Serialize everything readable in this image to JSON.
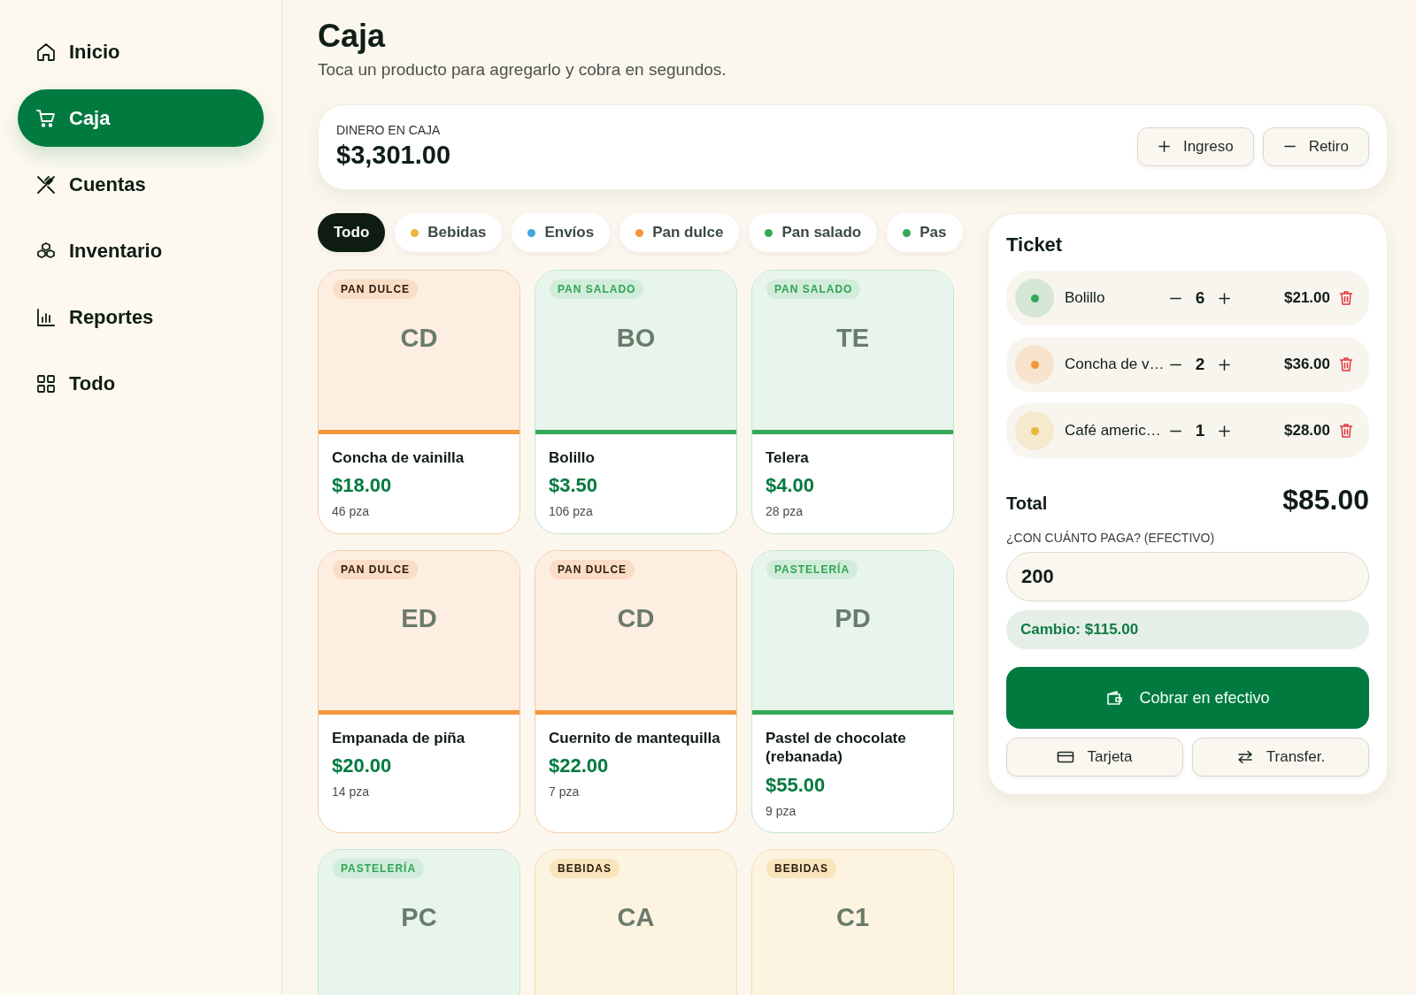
{
  "sidebar": {
    "items": [
      {
        "label": "Inicio",
        "kind": "home",
        "selected": false
      },
      {
        "label": "Caja",
        "kind": "cart",
        "selected": true
      },
      {
        "label": "Cuentas",
        "kind": "utensils",
        "selected": false
      },
      {
        "label": "Inventario",
        "kind": "boxes",
        "selected": false
      },
      {
        "label": "Reportes",
        "kind": "chart",
        "selected": false
      },
      {
        "label": "Todo",
        "kind": "grid",
        "selected": false
      }
    ]
  },
  "header": {
    "title": "Caja",
    "subtitle": "Toca un producto para agregarlo y cobra en segundos."
  },
  "cash": {
    "label": "DINERO EN CAJA",
    "amount": "$3,301.00",
    "buttons": [
      {
        "label": "Ingreso",
        "kind": "plus"
      },
      {
        "label": "Retiro",
        "kind": "minus"
      }
    ]
  },
  "filters": [
    {
      "label": "Todo",
      "selected": true
    },
    {
      "label": "Bebidas",
      "selected": false,
      "color": "#e8b83a"
    },
    {
      "label": "Envíos",
      "selected": false,
      "color": "#3fa6e0"
    },
    {
      "label": "Pan dulce",
      "selected": false,
      "color": "#f5963a"
    },
    {
      "label": "Pan salado",
      "selected": false,
      "color": "#35a857"
    },
    {
      "label": "Pas",
      "selected": false,
      "color": "#35a857"
    }
  ],
  "products": [
    {
      "tag": "PAN DULCE",
      "kind": "dulce",
      "initials": "CD",
      "name": "Concha de vainilla",
      "price": "$18.00",
      "stock": "46 pza"
    },
    {
      "tag": "PAN SALADO",
      "kind": "salado",
      "initials": "BO",
      "name": "Bolillo",
      "price": "$3.50",
      "stock": "106 pza"
    },
    {
      "tag": "PAN SALADO",
      "kind": "salado",
      "initials": "TE",
      "name": "Telera",
      "price": "$4.00",
      "stock": "28 pza"
    },
    {
      "tag": "PAN DULCE",
      "kind": "dulce",
      "initials": "ED",
      "name": "Empanada de piña",
      "price": "$20.00",
      "stock": "14 pza"
    },
    {
      "tag": "PAN DULCE",
      "kind": "dulce",
      "initials": "CD",
      "name": "Cuernito de mantequilla",
      "price": "$22.00",
      "stock": "7 pza"
    },
    {
      "tag": "PASTELERÍA",
      "kind": "pasteleria",
      "initials": "PD",
      "name": "Pastel de chocolate (rebanada)",
      "price": "$55.00",
      "stock": "9 pza"
    },
    {
      "tag": "PASTELERÍA",
      "kind": "pasteleria",
      "initials": "PC"
    },
    {
      "tag": "BEBIDAS",
      "kind": "bebidas",
      "initials": "CA"
    },
    {
      "tag": "BEBIDAS",
      "kind": "bebidas",
      "initials": "C1"
    }
  ],
  "ticket": {
    "title": "Ticket",
    "items": [
      {
        "name": "Bolillo",
        "color": "#35a857",
        "qty": "6",
        "price": "$21.00"
      },
      {
        "name": "Concha de v…",
        "color": "#f5963a",
        "qty": "2",
        "price": "$36.00"
      },
      {
        "name": "Café americ…",
        "color": "#e8b83a",
        "qty": "1",
        "price": "$28.00"
      }
    ],
    "total_label": "Total",
    "total": "$85.00",
    "pay_label": "¿CON CUÁNTO PAGA? (EFECTIVO)",
    "pay_value": "200",
    "change": "Cambio: $115.00",
    "charge_button": "Cobrar en efectivo",
    "alt_buttons": [
      {
        "label": "Tarjeta",
        "kind": "card"
      },
      {
        "label": "Transfer.",
        "kind": "transfer"
      }
    ]
  }
}
